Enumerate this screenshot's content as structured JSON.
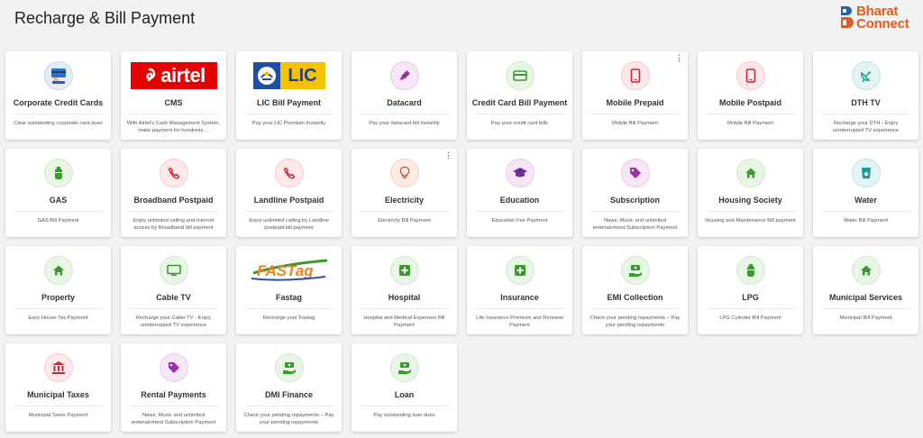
{
  "header": {
    "title": "Recharge & Bill Payment",
    "brand_line1": "Bharat",
    "brand_line2": "Connect"
  },
  "colors": {
    "brand_orange": "#e55a1f",
    "brand_blue": "#1f5fae",
    "icon_green": "#3a9a2e",
    "icon_red": "#c62838",
    "icon_purple": "#9b2fa6"
  },
  "cards": [
    {
      "title": "Corporate Credit Cards",
      "desc": "Clear outstanding corporate card dues",
      "icon": "corporate-card-illustration-icon"
    },
    {
      "title": "CMS",
      "desc": "With Airtel's Cash Management System, make payment for hundreds ...",
      "icon": "airtel-logo",
      "logo_text": "airtel"
    },
    {
      "title": "LIC Bill Payment",
      "desc": "Pay your LIC Premium Instantly",
      "icon": "lic-logo",
      "logo_text": "LIC"
    },
    {
      "title": "Datacard",
      "desc": "Pay your datacard bill instantly",
      "icon": "usb-datacard-icon"
    },
    {
      "title": "Credit Card Bill Payment",
      "desc": "Pay your credit card bills",
      "icon": "credit-card-icon"
    },
    {
      "title": "Mobile Prepaid",
      "desc": "Mobile Bill Payment",
      "icon": "mobile-phone-icon"
    },
    {
      "title": "Mobile Postpaid",
      "desc": "Mobile Bill Payment",
      "icon": "mobile-phone-icon"
    },
    {
      "title": "DTH TV",
      "desc": "Recharge your DTH - Enjoy uninterrupted TV experience",
      "icon": "satellite-dish-icon"
    },
    {
      "title": "GAS",
      "desc": "GAS Bill Payment",
      "icon": "gas-cylinder-icon"
    },
    {
      "title": "Broadband Postpaid",
      "desc": "Enjoy unlimited calling and Internet access by Broadband bill payment",
      "icon": "phone-call-icon"
    },
    {
      "title": "Landline Postpaid",
      "desc": "Enjoy unlimited calling by Landline postpaid bill payment",
      "icon": "phone-call-icon"
    },
    {
      "title": "Electricity",
      "desc": "Electricity Bill Payment",
      "icon": "light-bulb-icon"
    },
    {
      "title": "Education",
      "desc": "Education Fee Payment",
      "icon": "graduation-cap-icon"
    },
    {
      "title": "Subscription",
      "desc": "News, Music and unlimited entertainment Subscription Payment",
      "icon": "tag-icon"
    },
    {
      "title": "Housing Society",
      "desc": "Housing and Maintenance Bill payment",
      "icon": "home-icon"
    },
    {
      "title": "Water",
      "desc": "Water Bill Payment",
      "icon": "water-tap-icon"
    },
    {
      "title": "Property",
      "desc": "Easy House Tax Payment",
      "icon": "home-icon"
    },
    {
      "title": "Cable TV",
      "desc": "Recharge your Cable TV - Enjoy uninterrupted TV experience",
      "icon": "tv-icon"
    },
    {
      "title": "Fastag",
      "desc": "Recharge your Fastag",
      "icon": "fastag-logo",
      "logo_text": "FASTag"
    },
    {
      "title": "Hospital",
      "desc": "Hospital and Medical Expenses Bill Payment",
      "icon": "medical-cross-icon"
    },
    {
      "title": "Insurance",
      "desc": "Life Insurance Premium and Renewal Payment",
      "icon": "medical-cross-icon"
    },
    {
      "title": "EMI Collection",
      "desc": "Check your pending repayments – Pay your pending repayments",
      "icon": "money-hand-icon"
    },
    {
      "title": "LPG",
      "desc": "LPG Cylinder Bill Payment",
      "icon": "gas-cylinder-icon"
    },
    {
      "title": "Municipal Services",
      "desc": "Municipal Bill Payment",
      "icon": "home-icon"
    },
    {
      "title": "Municipal Taxes",
      "desc": "Municipal Taxes Payment",
      "icon": "bank-building-icon"
    },
    {
      "title": "Rental Payments",
      "desc": "News, Music and unlimited entertainment Subscription Payment",
      "icon": "tag-icon"
    },
    {
      "title": "DMI Finance",
      "desc": "Check your pending repayments – Pay your pending repayments",
      "icon": "money-hand-icon"
    },
    {
      "title": "Loan",
      "desc": "Pay outstanding loan dues",
      "icon": "money-hand-icon"
    }
  ]
}
